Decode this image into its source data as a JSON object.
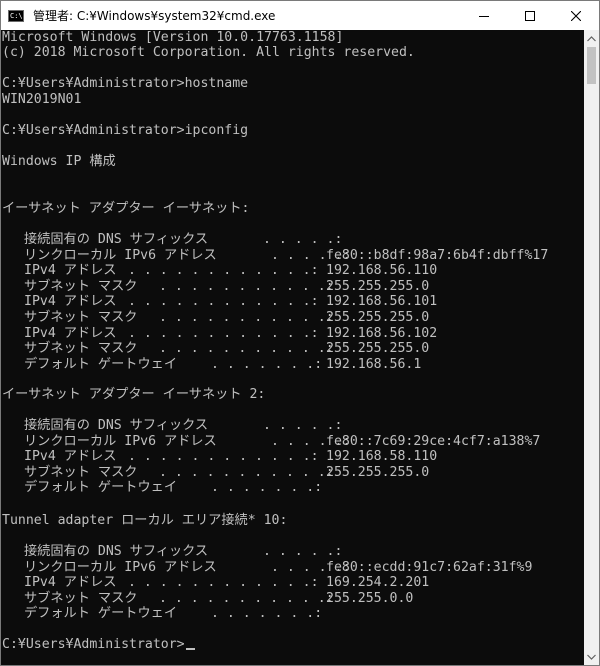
{
  "window": {
    "title": "管理者: C:¥Windows¥system32¥cmd.exe",
    "app_icon": "cmd-icon",
    "app_icon_text": "C:\\",
    "controls": [
      "minimize-icon",
      "maximize-icon",
      "close-icon"
    ]
  },
  "console": {
    "header": [
      "Microsoft Windows [Version 10.0.17763.1158]",
      "(c) 2018 Microsoft Corporation. All rights reserved."
    ],
    "prompt1": "C:¥Users¥Administrator>hostname",
    "hostname_output": "WIN2019N01",
    "prompt2": "C:¥Users¥Administrator>ipconfig",
    "ip_title": "Windows IP 構成",
    "adapters": [
      {
        "heading": "イーサネット アダプター イーサネット:",
        "entries": [
          {
            "label": "接続固有の DNS サフィックス",
            "dots": ". . . . .:",
            "value": ""
          },
          {
            "label": "リンクローカル IPv6 アドレス",
            "dots": ". . . . .:",
            "value": "fe80::b8df:98a7:6b4f:dbff%17"
          },
          {
            "label": "IPv4 アドレス",
            "dots": ". . . . . . . . . . . .:",
            "value": "192.168.56.110"
          },
          {
            "label": "サブネット マスク",
            "dots": ". . . . . . . . . . .:",
            "value": "255.255.255.0"
          },
          {
            "label": "IPv4 アドレス",
            "dots": ". . . . . . . . . . . .:",
            "value": "192.168.56.101"
          },
          {
            "label": "サブネット マスク",
            "dots": ". . . . . . . . . . .:",
            "value": "255.255.255.0"
          },
          {
            "label": "IPv4 アドレス",
            "dots": ". . . . . . . . . . . .:",
            "value": "192.168.56.102"
          },
          {
            "label": "サブネット マスク",
            "dots": ". . . . . . . . . . .:",
            "value": "255.255.255.0"
          },
          {
            "label": "デフォルト ゲートウェイ",
            "dots": ". . . . . . .:",
            "value": "192.168.56.1"
          }
        ]
      },
      {
        "heading": "イーサネット アダプター イーサネット 2:",
        "entries": [
          {
            "label": "接続固有の DNS サフィックス",
            "dots": ". . . . .:",
            "value": ""
          },
          {
            "label": "リンクローカル IPv6 アドレス",
            "dots": ". . . . .:",
            "value": "fe80::7c69:29ce:4cf7:a138%7"
          },
          {
            "label": "IPv4 アドレス",
            "dots": ". . . . . . . . . . . .:",
            "value": "192.168.58.110"
          },
          {
            "label": "サブネット マスク",
            "dots": ". . . . . . . . . . .:",
            "value": "255.255.255.0"
          },
          {
            "label": "デフォルト ゲートウェイ",
            "dots": ". . . . . . .:",
            "value": ""
          }
        ]
      },
      {
        "heading": "Tunnel adapter ローカル エリア接続* 10:",
        "entries": [
          {
            "label": "接続固有の DNS サフィックス",
            "dots": ". . . . .:",
            "value": ""
          },
          {
            "label": "リンクローカル IPv6 アドレス",
            "dots": ". . . . .:",
            "value": "fe80::ecdd:91c7:62af:31f%9"
          },
          {
            "label": "IPv4 アドレス",
            "dots": ". . . . . . . . . . . .:",
            "value": "169.254.2.201"
          },
          {
            "label": "サブネット マスク",
            "dots": ". . . . . . . . . . .:",
            "value": "255.255.0.0"
          },
          {
            "label": "デフォルト ゲートウェイ",
            "dots": ". . . . . . .:",
            "value": ""
          }
        ]
      }
    ],
    "final_prompt": "C:¥Users¥Administrator>"
  },
  "colors": {
    "console_bg": "#0c0c0c",
    "console_text": "#c0c0c0",
    "titlebar_bg": "#ffffff"
  }
}
